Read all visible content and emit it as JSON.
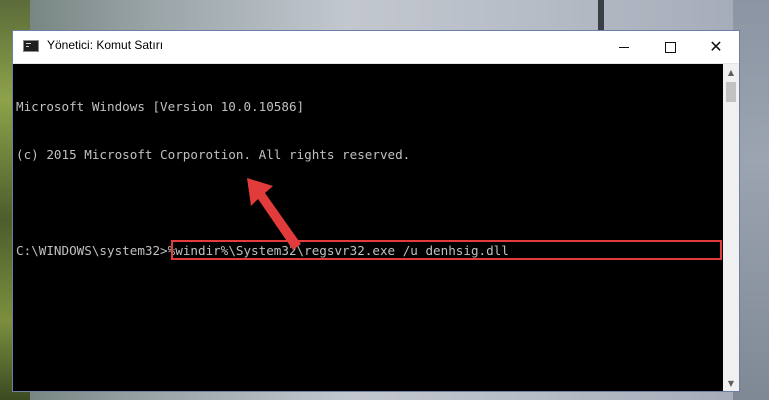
{
  "window": {
    "title": "Yönetici: Komut Satırı",
    "icon": "cmd-icon"
  },
  "controls": {
    "minimize_icon": "minimize-icon",
    "maximize_icon": "maximize-icon",
    "close_icon": "close-icon"
  },
  "console": {
    "lines": [
      "Microsoft Windows [Version 10.0.10586]",
      "(c) 2015 Microsoft Corporotion. All rights reserved.",
      ""
    ],
    "prompt": "C:\\WINDOWS\\system32>",
    "command": "%windir%\\System32\\regsvr32.exe /u denhsig.dll"
  },
  "annotation": {
    "highlight_color": "#e23b3b",
    "arrow_color": "#e23b3b"
  },
  "scrollbar": {
    "up_icon": "scroll-up-icon",
    "down_icon": "scroll-down-icon"
  }
}
